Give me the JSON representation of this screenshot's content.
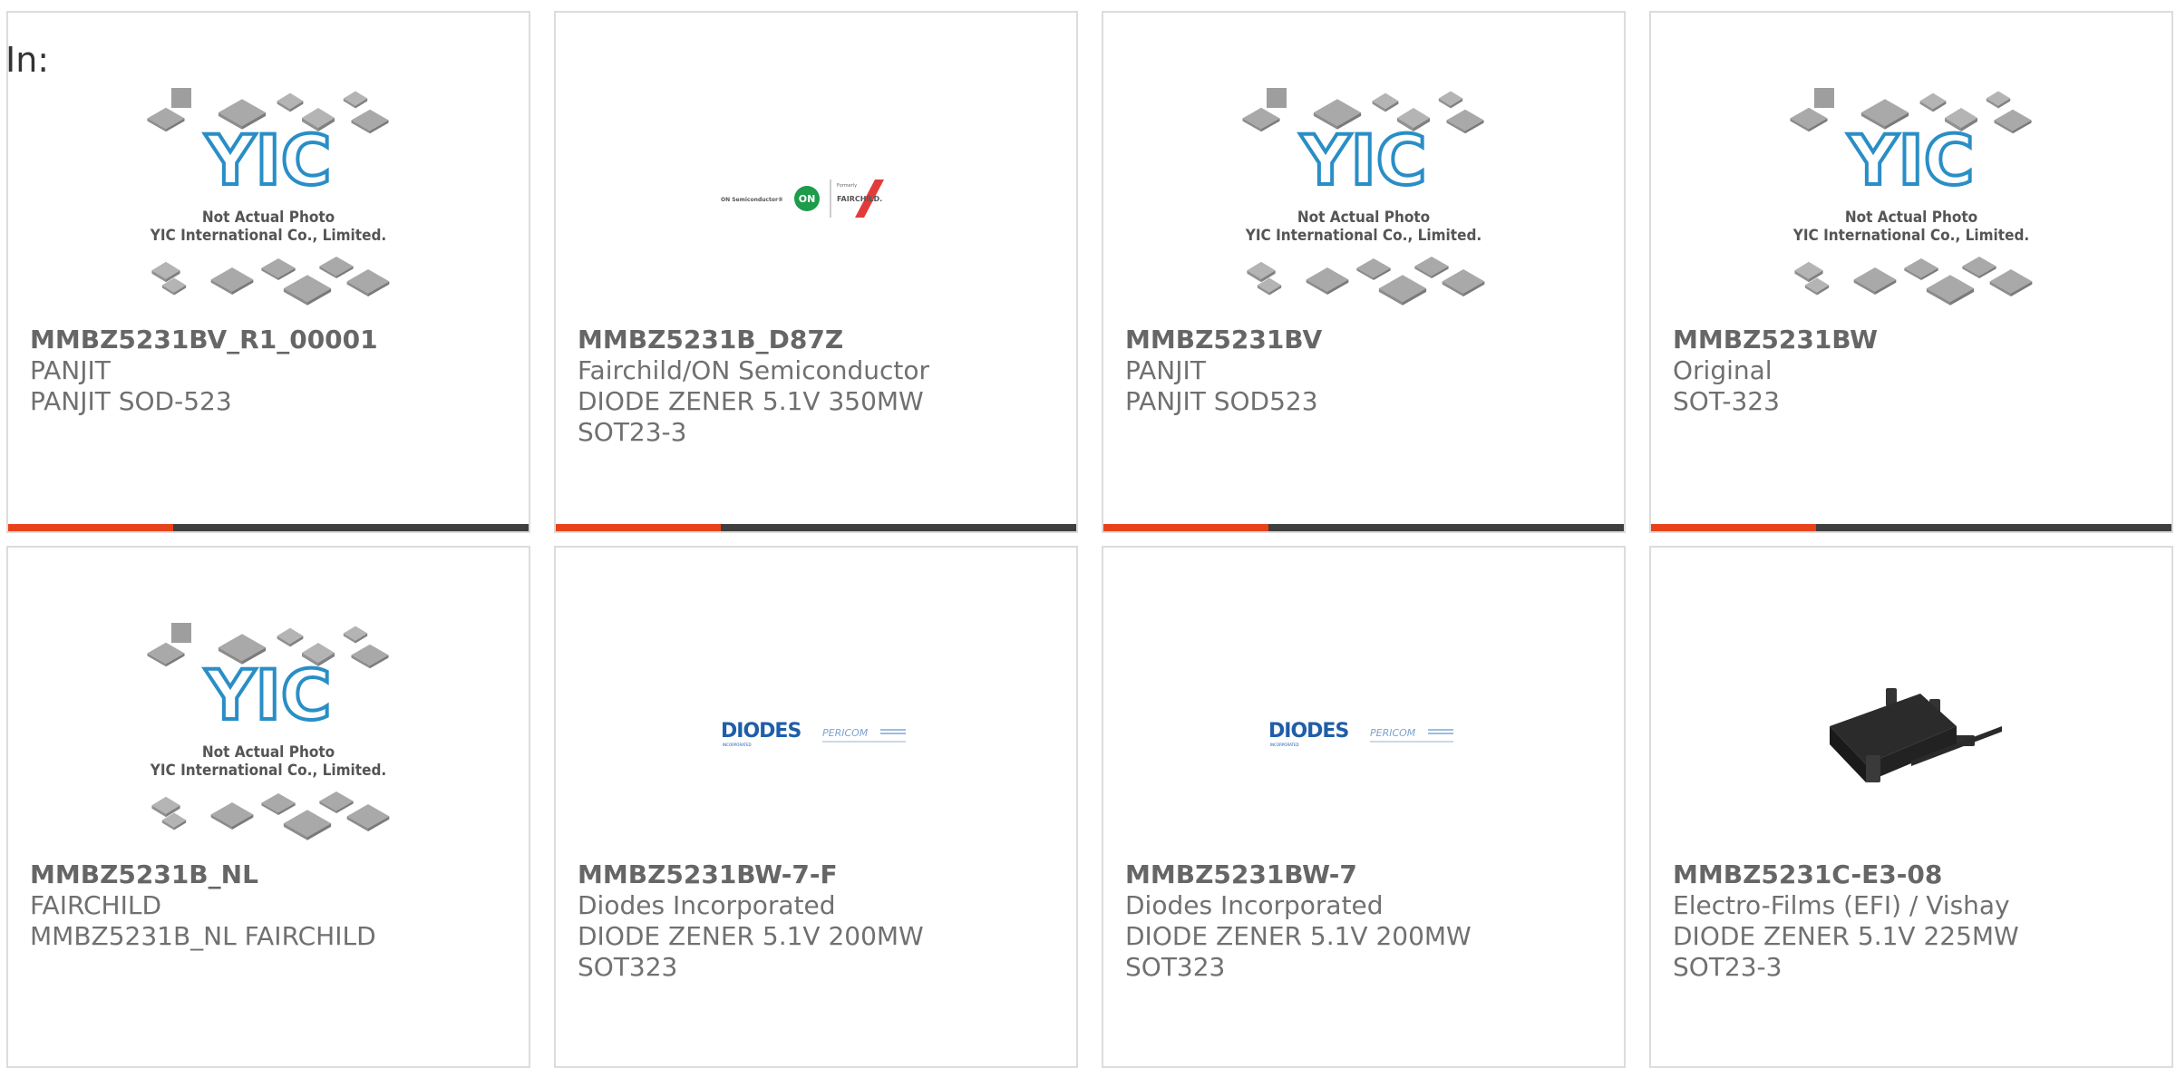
{
  "header": {
    "in_label": "In:"
  },
  "colors": {
    "accent": "#e8421c",
    "bar": "#3f3f3f",
    "yic_blue": "#2a8ec6",
    "border": "#dcdcdc"
  },
  "thumb_text": {
    "yic_line1": "Not Actual Photo",
    "yic_line2": "YIC International Co., Limited.",
    "on_semi": "ON Semiconductor®",
    "formerly": "Formerly",
    "fairchild": "FAIRCHILD.",
    "diodes": "DIODES",
    "diodes_sub": "INCORPORATED",
    "pericom": "PERICOM"
  },
  "products": [
    {
      "part": "MMBZ5231BV_R1_00001",
      "maker": "PANJIT",
      "desc1": "PANJIT SOD-523",
      "desc2": "",
      "image": "yic-placeholder"
    },
    {
      "part": "MMBZ5231B_D87Z",
      "maker": "Fairchild/ON Semiconductor",
      "desc1": "DIODE ZENER 5.1V 350MW",
      "desc2": "SOT23-3",
      "image": "on-fairchild-logo"
    },
    {
      "part": "MMBZ5231BV",
      "maker": "PANJIT",
      "desc1": "PANJIT SOD523",
      "desc2": "",
      "image": "yic-placeholder"
    },
    {
      "part": "MMBZ5231BW",
      "maker": "Original",
      "desc1": "SOT-323",
      "desc2": "",
      "image": "yic-placeholder"
    },
    {
      "part": "MMBZ5231B_NL",
      "maker": "FAIRCHILD",
      "desc1": "MMBZ5231B_NL FAIRCHILD",
      "desc2": "",
      "image": "yic-placeholder"
    },
    {
      "part": "MMBZ5231BW-7-F",
      "maker": "Diodes Incorporated",
      "desc1": "DIODE ZENER 5.1V 200MW",
      "desc2": "SOT323",
      "image": "diodes-pericom-logo"
    },
    {
      "part": "MMBZ5231BW-7",
      "maker": "Diodes Incorporated",
      "desc1": "DIODE ZENER 5.1V 200MW",
      "desc2": "SOT323",
      "image": "diodes-pericom-logo"
    },
    {
      "part": "MMBZ5231C-E3-08",
      "maker": "Electro-Films (EFI) / Vishay",
      "desc1": "DIODE ZENER 5.1V 225MW",
      "desc2": "SOT23-3",
      "image": "sot23-package-photo"
    }
  ]
}
